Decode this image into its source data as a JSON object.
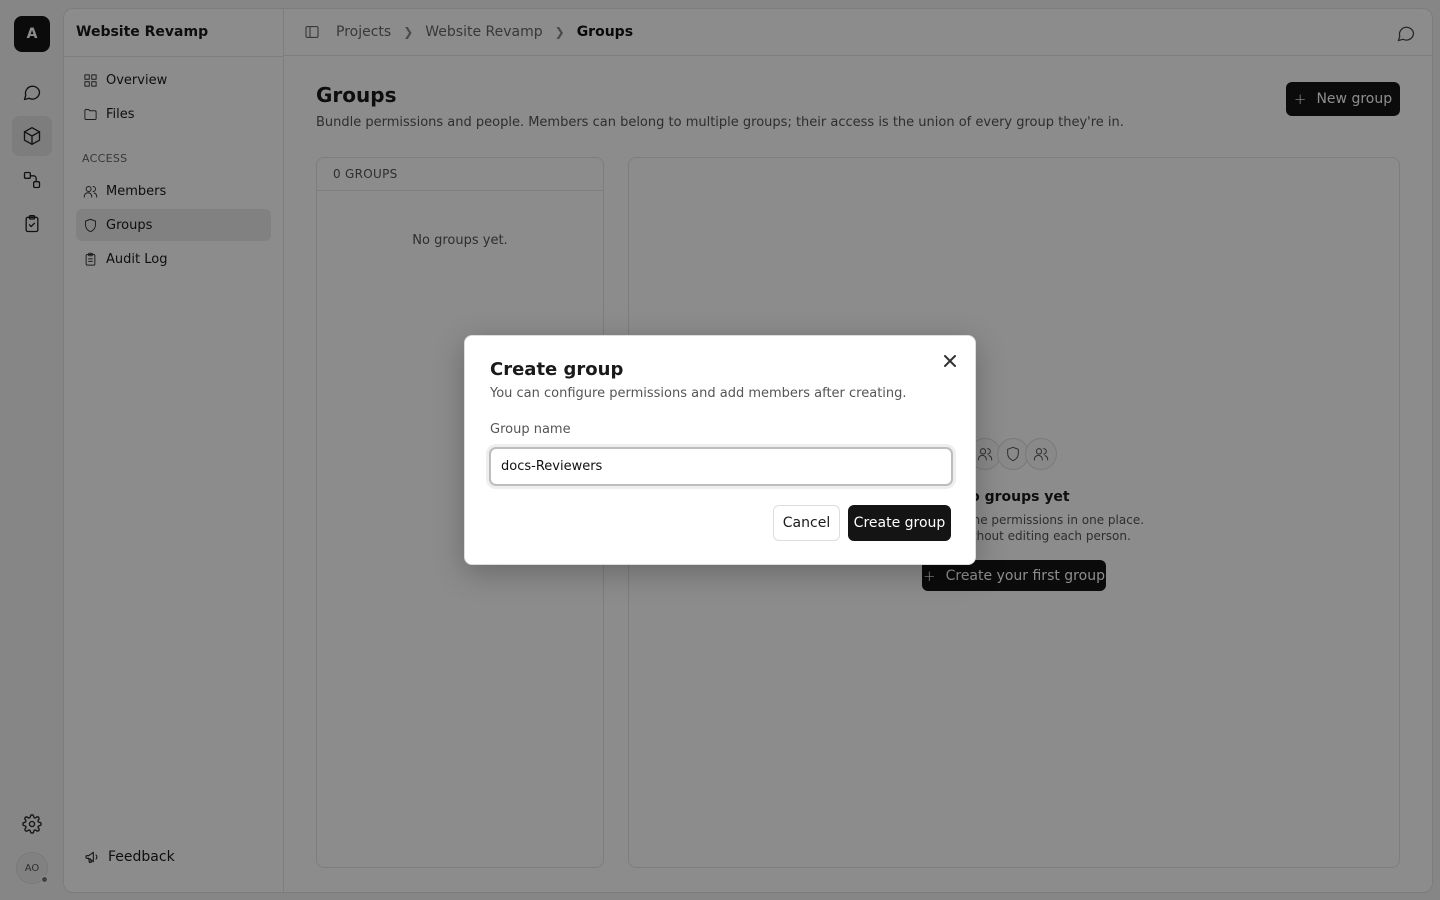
{
  "rail": {
    "logo": "A",
    "avatar": "AO"
  },
  "sidebar": {
    "project": "Website Revamp",
    "items": [
      {
        "label": "Overview",
        "icon": "overview-icon"
      },
      {
        "label": "Files",
        "icon": "folder-icon"
      }
    ],
    "section": "ACCESS",
    "access_items": [
      {
        "label": "Members",
        "icon": "users-icon"
      },
      {
        "label": "Groups",
        "icon": "shield-icon",
        "active": true
      },
      {
        "label": "Audit Log",
        "icon": "clipboard-icon"
      }
    ],
    "feedback": "Feedback"
  },
  "breadcrumb": [
    "Projects",
    "Website Revamp",
    "Groups"
  ],
  "main": {
    "title": "Groups",
    "subtitle": "Bundle permissions and people. Members can belong to multiple groups; their access is the union of every group they're in.",
    "new_group": "New group",
    "count_label": "0 GROUPS",
    "empty_list": "No groups yet.",
    "empty_title": "No groups yet",
    "empty_desc_1": "d grant the same permissions in one place.",
    "empty_desc_2": "y to scale without editing each person.",
    "empty_button": "Create your first group"
  },
  "modal": {
    "title": "Create group",
    "subtitle": "You can configure permissions and add members after creating.",
    "field_label": "Group name",
    "field_value": "docs-Reviewers",
    "cancel": "Cancel",
    "create": "Create group"
  }
}
